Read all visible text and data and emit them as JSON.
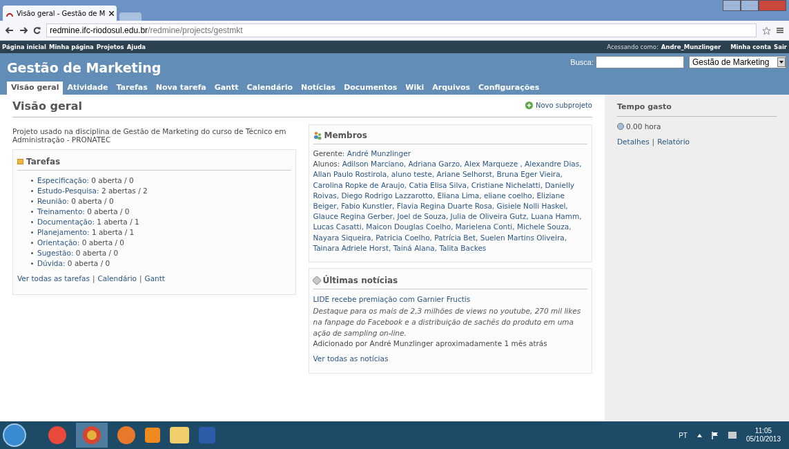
{
  "browser": {
    "tab_title": "Visão geral - Gestão de M",
    "url_host": "redmine.ifc-riodosul.edu.br",
    "url_path": "/redmine/projects/gestmkt"
  },
  "top_menu": {
    "links": [
      "Página inicial",
      "Minha página",
      "Projetos",
      "Ajuda"
    ],
    "logged_label": "Acessando como:",
    "user": "Andre_Munzlinger",
    "account_links": [
      "Minha conta",
      "Sair"
    ]
  },
  "header": {
    "title": "Gestão de Marketing",
    "search_label": "Busca:",
    "project_select": "Gestão de Marketing"
  },
  "tabs": [
    {
      "label": "Visão geral",
      "selected": true
    },
    {
      "label": "Atividade",
      "selected": false
    },
    {
      "label": "Tarefas",
      "selected": false
    },
    {
      "label": "Nova tarefa",
      "selected": false
    },
    {
      "label": "Gantt",
      "selected": false
    },
    {
      "label": "Calendário",
      "selected": false
    },
    {
      "label": "Notícias",
      "selected": false
    },
    {
      "label": "Documentos",
      "selected": false
    },
    {
      "label": "Wiki",
      "selected": false
    },
    {
      "label": "Arquivos",
      "selected": false
    },
    {
      "label": "Configurações",
      "selected": false
    }
  ],
  "page": {
    "title": "Visão geral",
    "new_subproject": "Novo subprojeto",
    "description": "Projeto usado na disciplina de Gestão de Marketing do curso de Técnico em Administração - PRONATEC"
  },
  "issues": {
    "title": "Tarefas",
    "items": [
      {
        "tracker": "Especificação:",
        "count": "0 aberta / 0"
      },
      {
        "tracker": "Estudo-Pesquisa:",
        "count": "2 abertas / 2"
      },
      {
        "tracker": "Reunião:",
        "count": "0 aberta / 0"
      },
      {
        "tracker": "Treinamento:",
        "count": "0 aberta / 0"
      },
      {
        "tracker": "Documentação:",
        "count": "1 aberta / 1"
      },
      {
        "tracker": "Planejamento:",
        "count": "1 aberta / 1"
      },
      {
        "tracker": "Orientação:",
        "count": "0 aberta / 0"
      },
      {
        "tracker": "Sugestão:",
        "count": "0 aberta / 0"
      },
      {
        "tracker": "Dúvida:",
        "count": "0 aberta / 0"
      }
    ],
    "links": [
      "Ver todas as tarefas",
      "Calendário",
      "Gantt"
    ],
    "separator": "|"
  },
  "members": {
    "title": "Membros",
    "manager_label": "Gerente:",
    "manager": "André Munzlinger",
    "students_label": "Alunos:",
    "students": "Adilson Marciano, Adriana Garzo, Alex Marqueze , Alexandre Dias, Allan Paulo Rostirola, aluno teste, Ariane Selhorst, Bruna Eger Vieira, Carolina Ropke de Araujo, Catia Elisa Silva, Cristiane Nichelatti, Danielly Roivas, Diego Rodrigo Lazzarotto, Eliana Lima, eliane coelho, Eliziane Beiger, Fabio Kunstler, Flavia Regina Duarte Rosa, Gisiele Nolli Haskel, Glauce Regina Gerber, Joel de Souza, Julia de Oliveira Gutz, Luana Hamm, Lucas Casatti, Maicon Douglas Coelho, Marielena Conti, Michele Souza, Nayara Siqueira, Patricia Coelho, Patrícia Bet, Suelen Martins Oliveira, Tainara Adriele Horst, Tainá Alana, Talita Backes"
  },
  "news": {
    "title": "Últimas notícias",
    "item_title": "LIDE recebe premiação com Garnier Fructis",
    "summary": "Destaque para os mais de 2,3 milhões de views no youtube, 270 mil likes na fanpage do Facebook e a distribuição de sachês do produto em uma ação de sampling on-line.",
    "meta": "Adicionado por André Munzlinger aproximadamente 1 mês atrás",
    "link": "Ver todas as notícias"
  },
  "sidebar": {
    "title": "Tempo gasto",
    "hours": "0.00 hora",
    "links": [
      "Detalhes",
      "Relatório"
    ],
    "separator": "|"
  },
  "taskbar": {
    "language": "PT",
    "time": "11:05",
    "date": "05/10/2013"
  }
}
